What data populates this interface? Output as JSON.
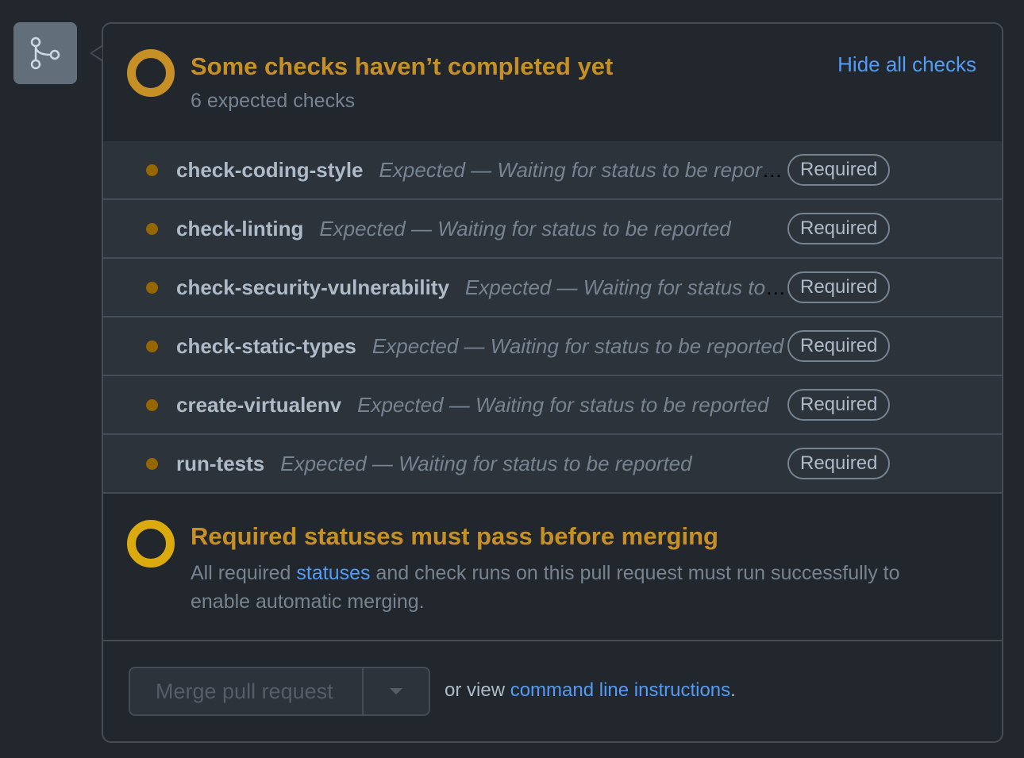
{
  "icons": {
    "merge_icon": "git-merge-icon",
    "pending_ring": "pending-ring-icon",
    "caret": "caret-down-icon"
  },
  "colors": {
    "background": "#22272e",
    "row_background": "#2d333b",
    "border": "#444c56",
    "pending_orange": "#c69026",
    "pending_yellow": "#daaa0e",
    "dot_color": "#966600",
    "link": "#539bf5",
    "muted_text": "#768390",
    "primary_text": "#adbac7"
  },
  "header": {
    "title": "Some checks haven’t completed yet",
    "subtitle": "6 expected checks",
    "hide_link": "Hide all checks"
  },
  "checks": [
    {
      "name": "check-coding-style",
      "description": "Expected — Waiting for status to be reported",
      "badge": "Required"
    },
    {
      "name": "check-linting",
      "description": "Expected — Waiting for status to be reported",
      "badge": "Required"
    },
    {
      "name": "check-security-vulnerability",
      "description": "Expected — Waiting for status to be reported",
      "badge": "Required"
    },
    {
      "name": "check-static-types",
      "description": "Expected — Waiting for status to be reported",
      "badge": "Required"
    },
    {
      "name": "create-virtualenv",
      "description": "Expected — Waiting for status to be reported",
      "badge": "Required"
    },
    {
      "name": "run-tests",
      "description": "Expected — Waiting for status to be reported",
      "badge": "Required"
    }
  ],
  "merge_status": {
    "title": "Required statuses must pass before merging",
    "desc_before": "All required ",
    "desc_link": "statuses",
    "desc_after": " and check runs on this pull request must run successfully to enable automatic merging."
  },
  "footer": {
    "merge_button": "Merge pull request",
    "cli_prefix": "or view ",
    "cli_link": "command line instructions",
    "cli_suffix": "."
  }
}
